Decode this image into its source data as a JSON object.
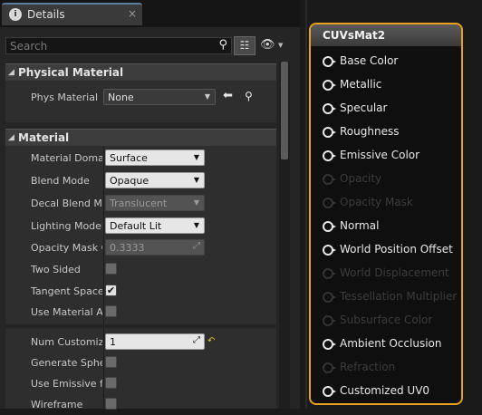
{
  "tab": {
    "title": "Details",
    "close": "×"
  },
  "search": {
    "placeholder": "Search"
  },
  "physical_material": {
    "header": "Physical Material",
    "rows": [
      {
        "label": "Phys Material",
        "value": "None"
      }
    ]
  },
  "material": {
    "header": "Material",
    "rows": [
      {
        "label": "Material Domain",
        "value": "Surface"
      },
      {
        "label": "Blend Mode",
        "value": "Opaque"
      },
      {
        "label": "Decal Blend Mode",
        "value": "Translucent"
      },
      {
        "label": "Lighting Model",
        "value": "Default Lit"
      },
      {
        "label": "Opacity Mask Clip Value",
        "value": "0.3333"
      },
      {
        "label": "Two Sided",
        "value": false
      },
      {
        "label": "Tangent Space Normal",
        "value": true
      },
      {
        "label": "Use Material Attributes",
        "value": false
      },
      {
        "label": "Num Customized UVs",
        "value": "1"
      },
      {
        "label": "Generate Spherical Particle Normals",
        "value": false
      },
      {
        "label": "Use Emissive for Static Lighting",
        "value": false
      },
      {
        "label": "Wireframe",
        "value": false
      }
    ]
  },
  "node": {
    "title": "CUVsMat2",
    "pins": [
      {
        "label": "Base Color",
        "enabled": true
      },
      {
        "label": "Metallic",
        "enabled": true
      },
      {
        "label": "Specular",
        "enabled": true
      },
      {
        "label": "Roughness",
        "enabled": true
      },
      {
        "label": "Emissive Color",
        "enabled": true
      },
      {
        "label": "Opacity",
        "enabled": false
      },
      {
        "label": "Opacity Mask",
        "enabled": false
      },
      {
        "label": "Normal",
        "enabled": true
      },
      {
        "label": "World Position Offset",
        "enabled": true
      },
      {
        "label": "World Displacement",
        "enabled": false
      },
      {
        "label": "Tessellation Multiplier",
        "enabled": false
      },
      {
        "label": "Subsurface Color",
        "enabled": false
      },
      {
        "label": "Ambient Occlusion",
        "enabled": true
      },
      {
        "label": "Refraction",
        "enabled": false
      },
      {
        "label": "Customized UV0",
        "enabled": true
      }
    ]
  }
}
